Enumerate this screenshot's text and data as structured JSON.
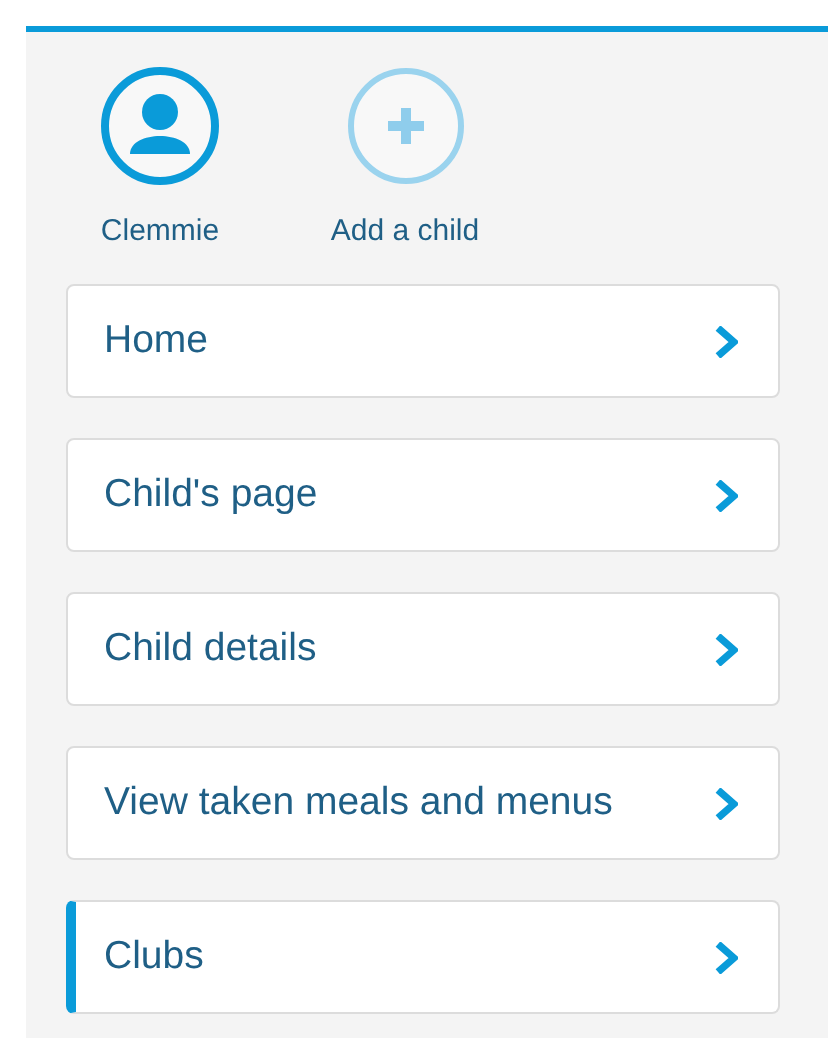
{
  "children": [
    {
      "kind": "child",
      "label": "Clemmie",
      "selected": true
    },
    {
      "kind": "add",
      "label": "Add a child",
      "selected": false
    }
  ],
  "menu": [
    {
      "label": "Home",
      "selected": false
    },
    {
      "label": "Child's page",
      "selected": false
    },
    {
      "label": "Child details",
      "selected": false
    },
    {
      "label": "View taken meals and menus",
      "selected": false
    },
    {
      "label": "Clubs",
      "selected": true
    }
  ]
}
